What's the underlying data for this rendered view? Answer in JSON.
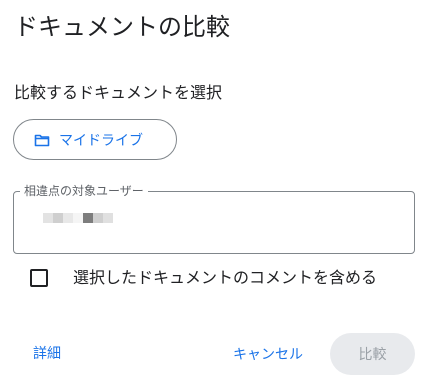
{
  "dialog": {
    "title": "ドキュメントの比較",
    "select_label": "比較するドキュメントを選択",
    "drive_chip": {
      "label": "マイドライブ",
      "icon": "folder-icon"
    },
    "target_user_field": {
      "label": "相違点の対象ユーザー",
      "value_pixel_colors": [
        "#ffffff",
        "#e3e3e3",
        "#cfcfcf",
        "#e8e8e8",
        "#f5f5f5",
        "#7d7d7d",
        "#cfcfcf",
        "#e0e0e0"
      ]
    },
    "include_comments": {
      "label": "選択したドキュメントのコメントを含める",
      "checked": false
    },
    "footer": {
      "details_link": "詳細",
      "cancel_label": "キャンセル",
      "compare_label": "比較",
      "compare_enabled": false
    }
  },
  "colors": {
    "accent": "#1a73e8",
    "border": "#80868b",
    "disabled_bg": "#e8eaed",
    "disabled_text": "#9aa0a6",
    "text": "#202124"
  }
}
